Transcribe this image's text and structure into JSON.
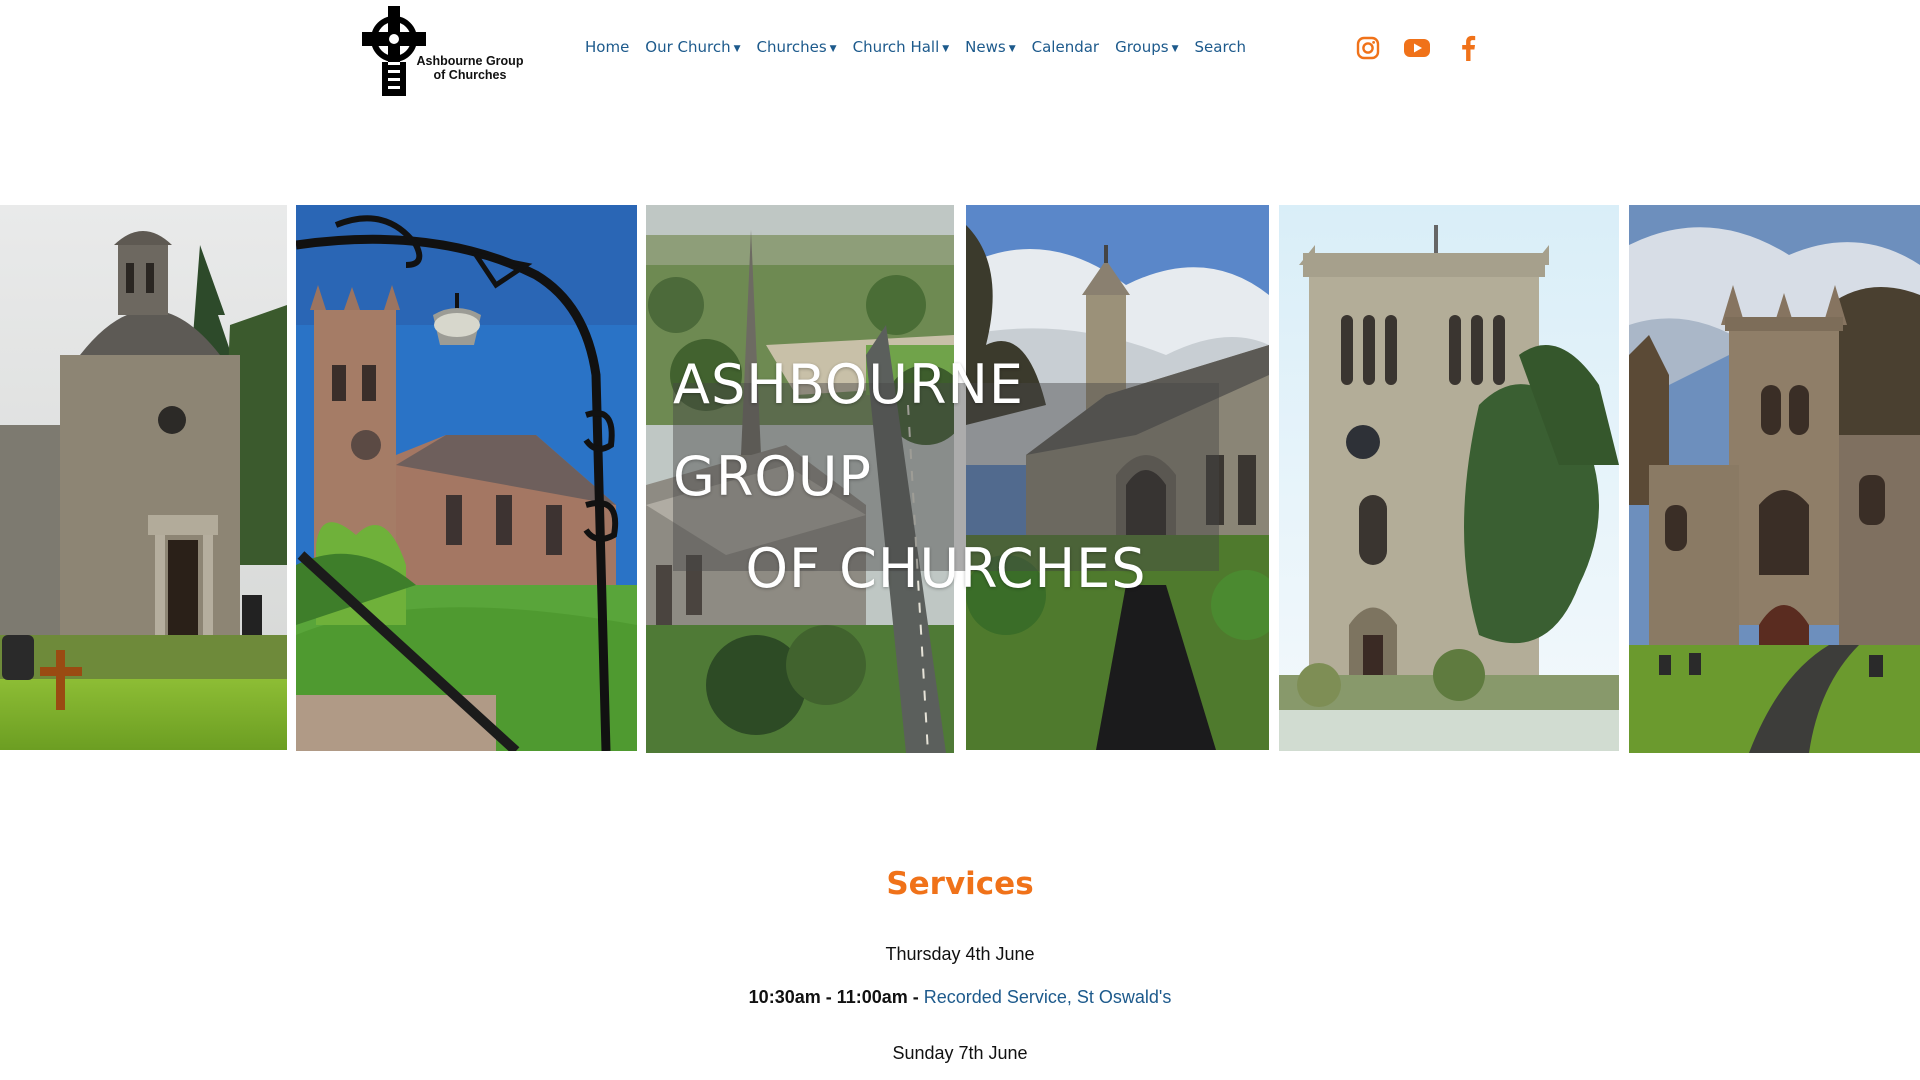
{
  "header": {
    "logo_text_line1": "Ashbourne Group",
    "logo_text_line2": "of Churches",
    "nav": [
      {
        "label": "Home",
        "dropdown": false
      },
      {
        "label": "Our Church",
        "dropdown": true
      },
      {
        "label": "Churches",
        "dropdown": true
      },
      {
        "label": "Church Hall",
        "dropdown": true
      },
      {
        "label": "News",
        "dropdown": true
      },
      {
        "label": "Calendar",
        "dropdown": false
      },
      {
        "label": "Groups",
        "dropdown": true
      },
      {
        "label": "Search",
        "dropdown": false
      }
    ],
    "dropdown_glyph": "▼",
    "social_icons": [
      "instagram-icon",
      "youtube-icon",
      "facebook-icon"
    ],
    "accent_color": "#f07219",
    "link_color": "#1d5a8c"
  },
  "banner": {
    "title_line1": "ASHBOURNE GROUP",
    "title_line2": "OF CHURCHES"
  },
  "services": {
    "heading": "Services",
    "day1": "Thursday 4th June",
    "entry1_time": "10:30am - 11:00am - ",
    "entry1_link": "Recorded Service, St Oswald's",
    "day2": "Sunday 7th June"
  }
}
